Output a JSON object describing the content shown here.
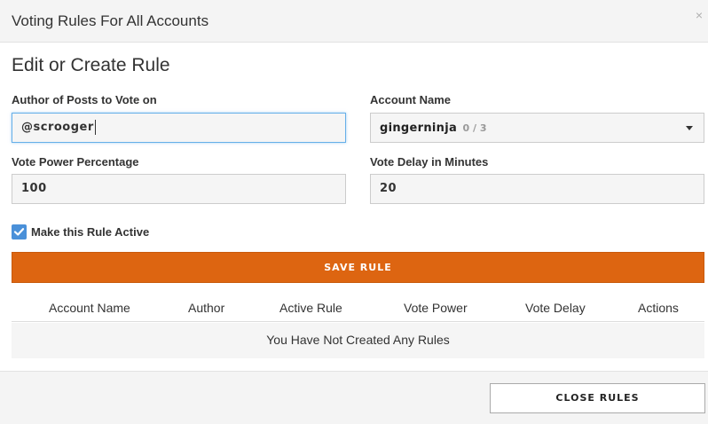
{
  "header": {
    "title": "Voting Rules For All Accounts",
    "close_glyph": "×",
    "close_icon": "close-icon"
  },
  "form": {
    "heading": "Edit or Create Rule",
    "author": {
      "label": "Author of Posts to Vote on",
      "value": "@scrooger"
    },
    "account": {
      "label": "Account Name",
      "value": "gingerninja",
      "count": "0 / 3",
      "icon": "dropdown-arrow-icon"
    },
    "vote_power": {
      "label": "Vote Power Percentage",
      "value": "100"
    },
    "vote_delay": {
      "label": "Vote Delay in Minutes",
      "value": "20"
    },
    "active": {
      "label": "Make this Rule Active",
      "checked": true,
      "icon": "checkmark-icon"
    },
    "save_label": "SAVE RULE"
  },
  "table": {
    "columns": [
      "Account Name",
      "Author",
      "Active Rule",
      "Vote Power",
      "Vote Delay",
      "Actions"
    ],
    "empty_message": "You Have Not Created Any Rules"
  },
  "footer": {
    "close_label": "CLOSE RULES"
  },
  "colors": {
    "accent": "#dd6511",
    "checkbox": "#4a90d9",
    "focus_border": "#66afe9"
  }
}
